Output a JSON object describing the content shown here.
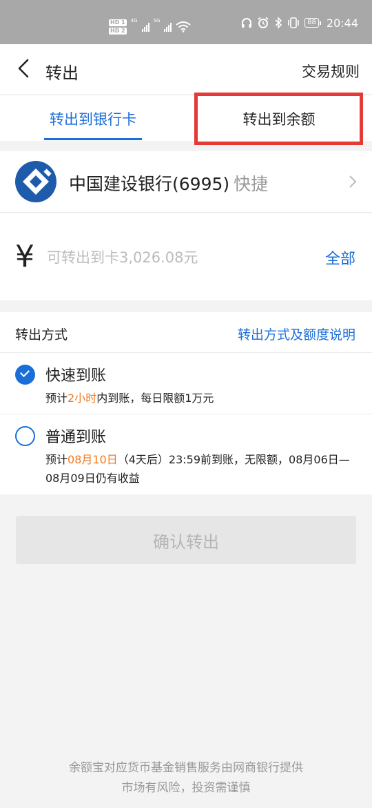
{
  "status_bar": {
    "hd_top": "HD 1",
    "hd_bottom": "HD 2",
    "net_4g": "4G",
    "net_5g": "5G",
    "battery": "88",
    "time": "20:44"
  },
  "header": {
    "title": "转出",
    "rules_link": "交易规则"
  },
  "tabs": [
    {
      "label": "转出到银行卡",
      "active": true
    },
    {
      "label": "转出到余额",
      "active": false
    }
  ],
  "bank": {
    "name": "中国建设银行(6995)",
    "tag": "快捷"
  },
  "amount": {
    "currency_symbol": "¥",
    "placeholder": "可转出到卡3,026.08元",
    "all_label": "全部"
  },
  "method": {
    "label": "转出方式",
    "explain_link": "转出方式及额度说明",
    "options": [
      {
        "title": "快速到账",
        "selected": true,
        "desc_prefix": "预计",
        "desc_highlight": "2小时",
        "desc_suffix": "内到账，每日限额1万元"
      },
      {
        "title": "普通到账",
        "selected": false,
        "desc_prefix": "预计",
        "desc_highlight": "08月10日",
        "desc_suffix": "（4天后）23:59前到账，无限额，08月06日—08月09日仍有收益"
      }
    ]
  },
  "confirm_label": "确认转出",
  "footer": {
    "line1": "余额宝对应货币基金销售服务由网商银行提供",
    "line2": "市场有风险，投资需谨慎"
  },
  "colors": {
    "accent": "#1a6ed8",
    "highlight": "#f07a20",
    "annotation_box": "#e53935",
    "bank_logo": "#1f5bab"
  }
}
